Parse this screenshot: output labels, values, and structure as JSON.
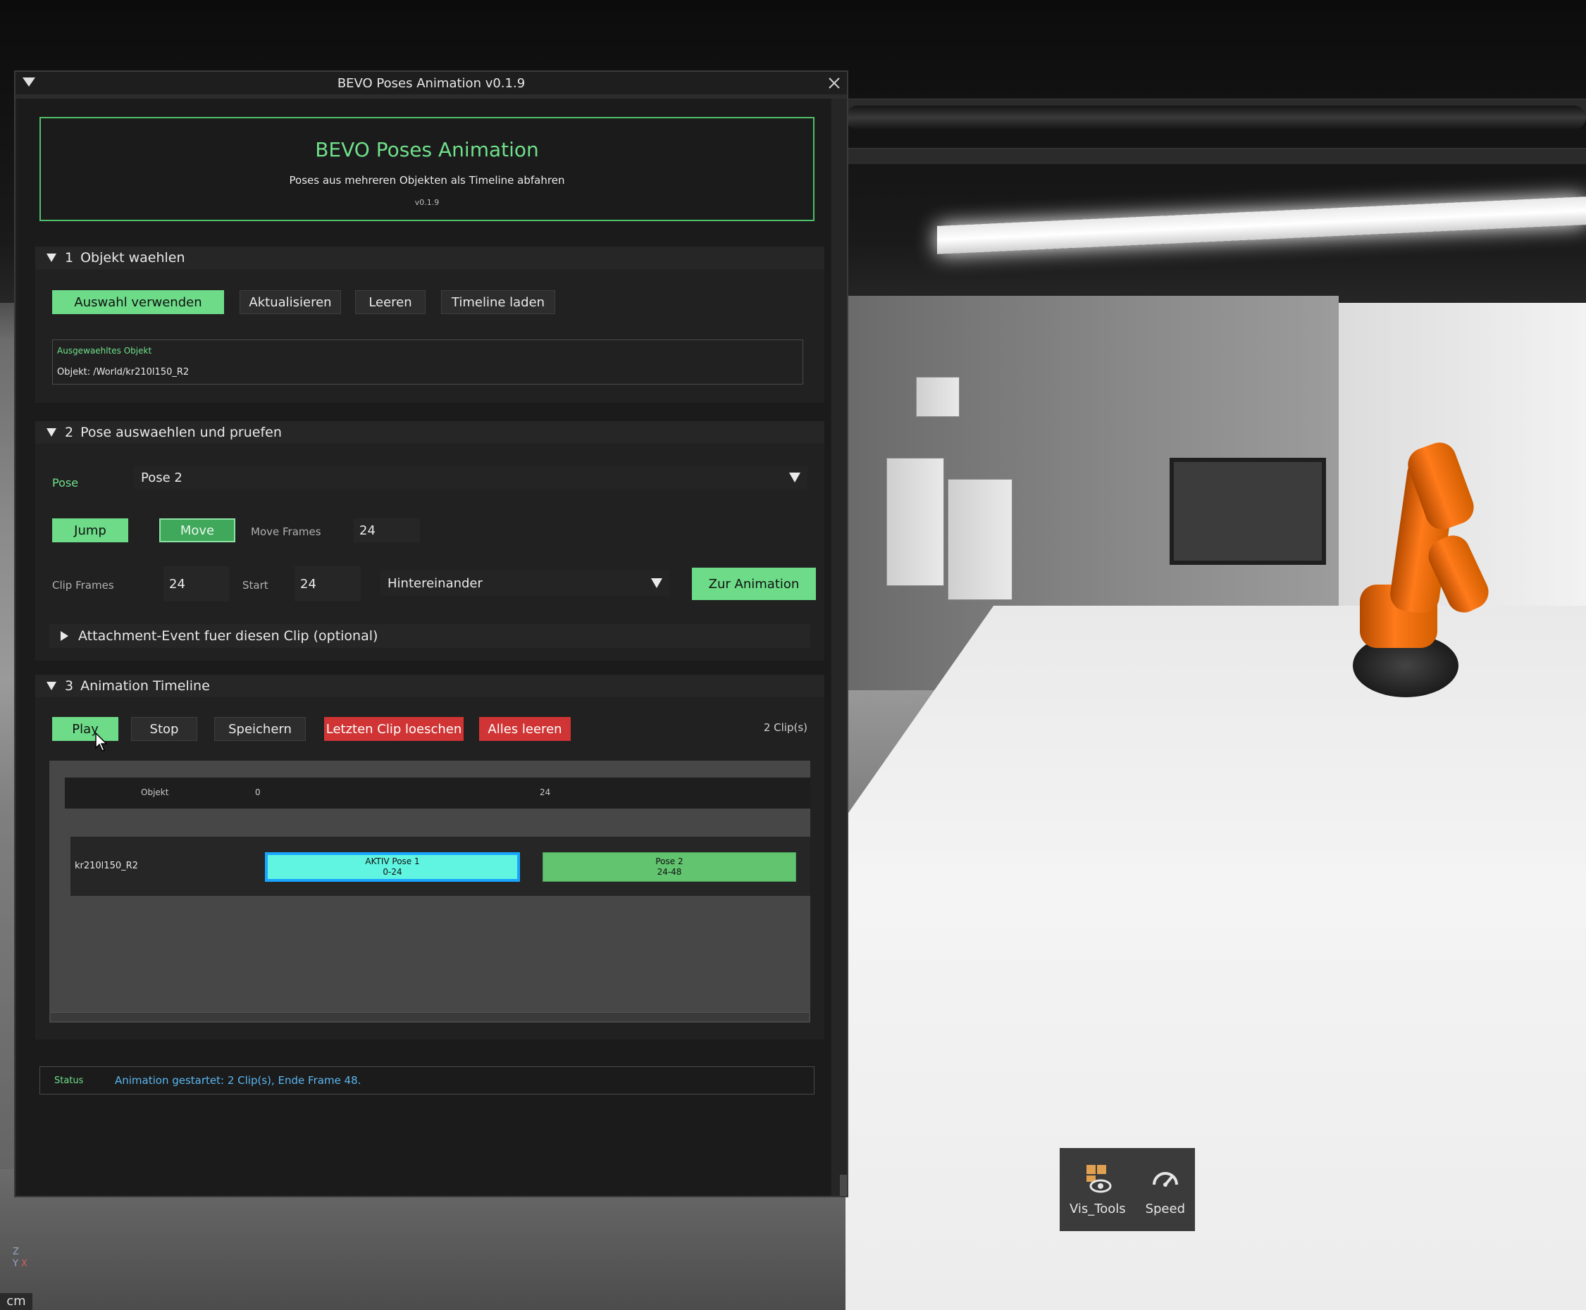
{
  "window": {
    "title": "BEVO Poses Animation v0.1.9"
  },
  "banner": {
    "title": "BEVO Poses Animation",
    "subtitle": "Poses aus mehreren Objekten als Timeline abfahren",
    "version": "v0.1.9"
  },
  "section1": {
    "number": "1",
    "title": "Objekt waehlen",
    "buttons": {
      "use_selection": "Auswahl verwenden",
      "refresh": "Aktualisieren",
      "clear": "Leeren",
      "load_timeline": "Timeline laden"
    },
    "selected_label": "Ausgewaehltes Objekt",
    "selected_value": "Objekt: /World/kr210l150_R2"
  },
  "section2": {
    "number": "2",
    "title": "Pose auswaehlen und pruefen",
    "pose_label": "Pose",
    "pose_value": "Pose 2",
    "jump_label": "Jump",
    "move_label": "Move",
    "move_frames_label": "Move Frames",
    "move_frames_value": "24",
    "clip_frames_label": "Clip Frames",
    "clip_frames_value": "24",
    "start_label": "Start",
    "start_value": "24",
    "mode_value": "Hintereinander",
    "to_animation_label": "Zur Animation",
    "attachment_title": "Attachment-Event fuer diesen Clip (optional)"
  },
  "section3": {
    "number": "3",
    "title": "Animation Timeline",
    "buttons": {
      "play": "Play",
      "stop": "Stop",
      "save": "Speichern",
      "delete_last": "Letzten Clip loeschen",
      "clear_all": "Alles leeren"
    },
    "clip_count": "2 Clip(s)",
    "timeline": {
      "column_object": "Objekt",
      "tick_0": "0",
      "tick_24": "24",
      "rows": [
        {
          "object": "kr210l150_R2",
          "clips": [
            {
              "line1": "AKTIV Pose 1",
              "line2": "0-24",
              "color": "#5ff5e0",
              "active": true
            },
            {
              "line1": "Pose 2",
              "line2": "24-48",
              "color": "#62c46f",
              "active": false
            }
          ]
        }
      ]
    }
  },
  "status": {
    "label": "Status",
    "text": "Animation gestartet: 2 Clip(s), Ende Frame 48."
  },
  "viewport_toolbar": {
    "vis_tools": "Vis_Tools",
    "speed": "Speed"
  },
  "unit": "cm",
  "axis": {
    "z": "Z",
    "y": "Y",
    "x": "X"
  },
  "colors": {
    "accent_green": "#6ddb88",
    "danger_red": "#d03434",
    "status_blue": "#5bb7f0",
    "active_clip": "#5ff5e0"
  }
}
